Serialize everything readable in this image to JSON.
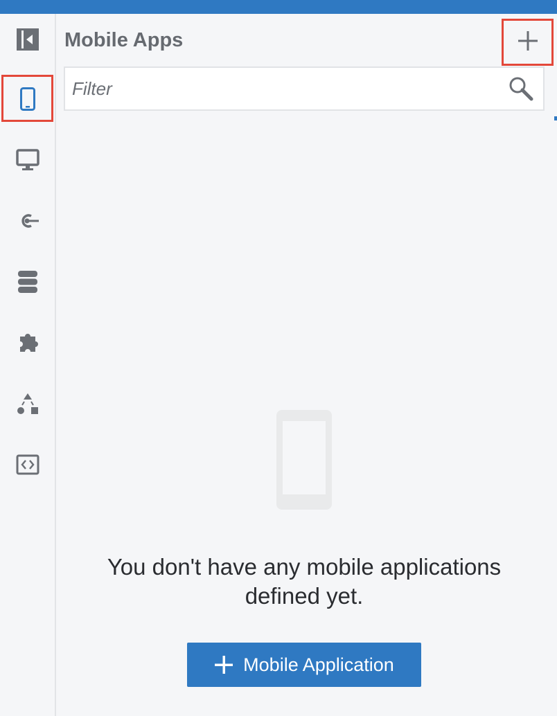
{
  "header": {
    "bar_color": "#2f79c2"
  },
  "sidebar": {
    "items": [
      {
        "name": "collapse-panel",
        "icon": "collapse-panel-icon"
      },
      {
        "name": "mobile-apps",
        "icon": "mobile-phone-icon",
        "selected": true
      },
      {
        "name": "web-apps",
        "icon": "desktop-monitor-icon"
      },
      {
        "name": "connectors",
        "icon": "connector-icon"
      },
      {
        "name": "storage",
        "icon": "database-icon"
      },
      {
        "name": "plugins",
        "icon": "puzzle-piece-icon"
      },
      {
        "name": "processes",
        "icon": "shapes-flow-icon"
      },
      {
        "name": "api",
        "icon": "code-icon"
      }
    ],
    "highlight_color": "#e3483a",
    "selected_icon_color": "#2f79c2"
  },
  "panel": {
    "title": "Mobile Apps",
    "add_button_icon": "plus-icon",
    "filter": {
      "placeholder": "Filter",
      "value": "",
      "icon": "search-icon"
    },
    "empty_state": {
      "illustration": "mobile-phone-illustration",
      "message": "You don't have any mobile applications defined yet.",
      "button_label": "Mobile Application",
      "button_icon": "plus-icon"
    }
  }
}
